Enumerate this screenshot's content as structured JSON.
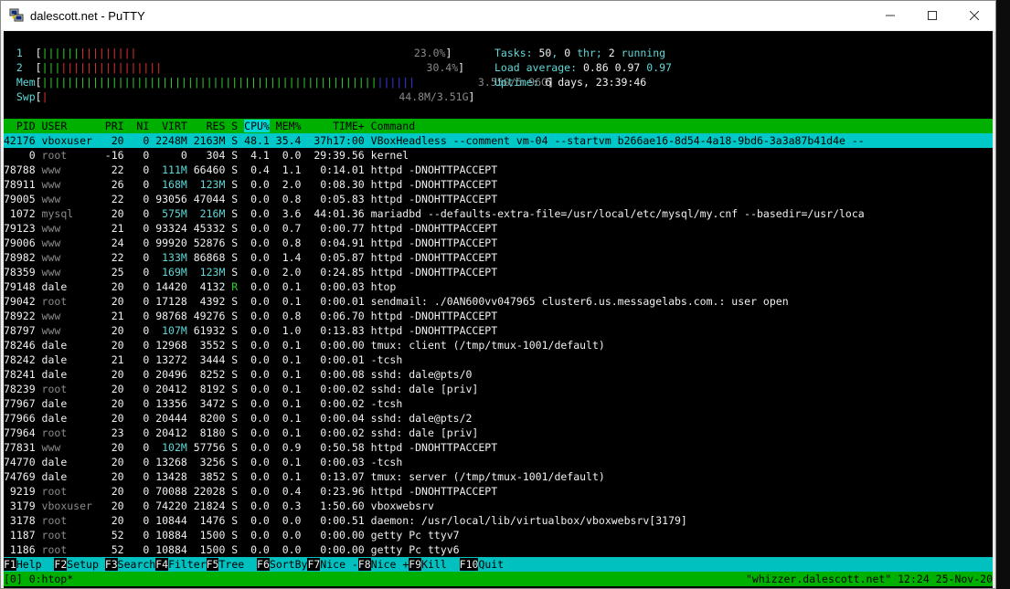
{
  "window": {
    "title": "dalescott.net - PuTTY",
    "icon": "putty-icon"
  },
  "meters": {
    "cpu1": {
      "label": "1",
      "bars_green": "||||||",
      "bars_red": "|||||||||",
      "value": "23.0%"
    },
    "cpu2": {
      "label": "2",
      "bars_green": "|||",
      "bars_red": "||||||||||||||||",
      "value": "30.4%"
    },
    "mem": {
      "label": "Mem",
      "bars_green": "|||||||||||||||||||||||||||||||||||||||||||||||||||||",
      "bars_blue": "||||||",
      "value": "3.55G/5.96G"
    },
    "swp": {
      "label": "Swp",
      "bars_red": "|",
      "value": "44.8M/3.51G"
    }
  },
  "summary": {
    "tasks_label": "Tasks:",
    "tasks_value": "50",
    "threads_value": "0",
    "thr_label": "thr;",
    "running_value": "2",
    "running_label": "running",
    "load_label": "Load average:",
    "load1": "0.86",
    "load5": "0.97",
    "load15": "0.97",
    "uptime_label": "Uptime:",
    "uptime_value": "6 days, 23:39:46"
  },
  "header": {
    "pid": "  PID",
    "user": "USER",
    "pri": "PRI",
    "ni": "NI",
    "virt": "VIRT",
    "res": "RES",
    "s": "S",
    "cpu": "CPU%",
    "mem": "MEM%",
    "time": "TIME+",
    "command": "Command"
  },
  "processes": [
    {
      "pid": "42176",
      "user": "vboxuser",
      "pri": "20",
      "ni": "0",
      "virt": "2248M",
      "res": "2163M",
      "s": "S",
      "cpu": "48.1",
      "mem": "35.4",
      "time": "37h17:00",
      "cmd": "VBoxHeadless --comment vm-04 --startvm b266ae16-8d54-4a18-9bd6-3a3a87b41d4e --"
    },
    {
      "pid": "0",
      "user": "root",
      "pri": "-16",
      "ni": "0",
      "virt": "0",
      "res": "304",
      "s": "S",
      "cpu": "4.1",
      "mem": "0.0",
      "time": "29:39.56",
      "cmd": "kernel"
    },
    {
      "pid": "78788",
      "user": "www",
      "pri": "22",
      "ni": "0",
      "virt": "111M",
      "res": "66460",
      "s": "S",
      "cpu": "0.4",
      "mem": "1.1",
      "time": "0:14.01",
      "cmd": "httpd -DNOHTTPACCEPT"
    },
    {
      "pid": "78911",
      "user": "www",
      "pri": "26",
      "ni": "0",
      "virt": "168M",
      "res": "123M",
      "s": "S",
      "cpu": "0.0",
      "mem": "2.0",
      "time": "0:08.30",
      "cmd": "httpd -DNOHTTPACCEPT"
    },
    {
      "pid": "79005",
      "user": "www",
      "pri": "22",
      "ni": "0",
      "virt": "93056",
      "res": "47044",
      "s": "S",
      "cpu": "0.0",
      "mem": "0.8",
      "time": "0:05.83",
      "cmd": "httpd -DNOHTTPACCEPT"
    },
    {
      "pid": "1072",
      "user": "mysql",
      "pri": "20",
      "ni": "0",
      "virt": "575M",
      "res": "216M",
      "s": "S",
      "cpu": "0.0",
      "mem": "3.6",
      "time": "44:01.36",
      "cmd": "mariadbd --defaults-extra-file=/usr/local/etc/mysql/my.cnf --basedir=/usr/loca"
    },
    {
      "pid": "79123",
      "user": "www",
      "pri": "21",
      "ni": "0",
      "virt": "93324",
      "res": "45332",
      "s": "S",
      "cpu": "0.0",
      "mem": "0.7",
      "time": "0:00.77",
      "cmd": "httpd -DNOHTTPACCEPT"
    },
    {
      "pid": "79006",
      "user": "www",
      "pri": "24",
      "ni": "0",
      "virt": "99920",
      "res": "52876",
      "s": "S",
      "cpu": "0.0",
      "mem": "0.8",
      "time": "0:04.91",
      "cmd": "httpd -DNOHTTPACCEPT"
    },
    {
      "pid": "78982",
      "user": "www",
      "pri": "22",
      "ni": "0",
      "virt": "133M",
      "res": "86868",
      "s": "S",
      "cpu": "0.0",
      "mem": "1.4",
      "time": "0:05.87",
      "cmd": "httpd -DNOHTTPACCEPT"
    },
    {
      "pid": "78359",
      "user": "www",
      "pri": "25",
      "ni": "0",
      "virt": "169M",
      "res": "123M",
      "s": "S",
      "cpu": "0.0",
      "mem": "2.0",
      "time": "0:24.85",
      "cmd": "httpd -DNOHTTPACCEPT"
    },
    {
      "pid": "79148",
      "user": "dale",
      "pri": "20",
      "ni": "0",
      "virt": "14420",
      "res": "4132",
      "s": "R",
      "cpu": "0.0",
      "mem": "0.1",
      "time": "0:00.03",
      "cmd": "htop"
    },
    {
      "pid": "79042",
      "user": "root",
      "pri": "20",
      "ni": "0",
      "virt": "17128",
      "res": "4392",
      "s": "S",
      "cpu": "0.0",
      "mem": "0.1",
      "time": "0:00.01",
      "cmd": "sendmail: ./0AN600vv047965 cluster6.us.messagelabs.com.: user open"
    },
    {
      "pid": "78922",
      "user": "www",
      "pri": "21",
      "ni": "0",
      "virt": "98768",
      "res": "49276",
      "s": "S",
      "cpu": "0.0",
      "mem": "0.8",
      "time": "0:06.70",
      "cmd": "httpd -DNOHTTPACCEPT"
    },
    {
      "pid": "78797",
      "user": "www",
      "pri": "20",
      "ni": "0",
      "virt": "107M",
      "res": "61932",
      "s": "S",
      "cpu": "0.0",
      "mem": "1.0",
      "time": "0:13.83",
      "cmd": "httpd -DNOHTTPACCEPT"
    },
    {
      "pid": "78246",
      "user": "dale",
      "pri": "20",
      "ni": "0",
      "virt": "12968",
      "res": "3552",
      "s": "S",
      "cpu": "0.0",
      "mem": "0.1",
      "time": "0:00.00",
      "cmd": "tmux: client (/tmp/tmux-1001/default)"
    },
    {
      "pid": "78242",
      "user": "dale",
      "pri": "21",
      "ni": "0",
      "virt": "13272",
      "res": "3444",
      "s": "S",
      "cpu": "0.0",
      "mem": "0.1",
      "time": "0:00.01",
      "cmd": "-tcsh"
    },
    {
      "pid": "78241",
      "user": "dale",
      "pri": "20",
      "ni": "0",
      "virt": "20496",
      "res": "8252",
      "s": "S",
      "cpu": "0.0",
      "mem": "0.1",
      "time": "0:00.08",
      "cmd": "sshd: dale@pts/0"
    },
    {
      "pid": "78239",
      "user": "root",
      "pri": "20",
      "ni": "0",
      "virt": "20412",
      "res": "8192",
      "s": "S",
      "cpu": "0.0",
      "mem": "0.1",
      "time": "0:00.02",
      "cmd": "sshd: dale [priv]"
    },
    {
      "pid": "77967",
      "user": "dale",
      "pri": "20",
      "ni": "0",
      "virt": "13356",
      "res": "3472",
      "s": "S",
      "cpu": "0.0",
      "mem": "0.1",
      "time": "0:00.02",
      "cmd": "-tcsh"
    },
    {
      "pid": "77966",
      "user": "dale",
      "pri": "20",
      "ni": "0",
      "virt": "20444",
      "res": "8200",
      "s": "S",
      "cpu": "0.0",
      "mem": "0.1",
      "time": "0:00.04",
      "cmd": "sshd: dale@pts/2"
    },
    {
      "pid": "77964",
      "user": "root",
      "pri": "23",
      "ni": "0",
      "virt": "20412",
      "res": "8180",
      "s": "S",
      "cpu": "0.0",
      "mem": "0.1",
      "time": "0:00.02",
      "cmd": "sshd: dale [priv]"
    },
    {
      "pid": "77831",
      "user": "www",
      "pri": "20",
      "ni": "0",
      "virt": "102M",
      "res": "57756",
      "s": "S",
      "cpu": "0.0",
      "mem": "0.9",
      "time": "0:50.58",
      "cmd": "httpd -DNOHTTPACCEPT"
    },
    {
      "pid": "74770",
      "user": "dale",
      "pri": "20",
      "ni": "0",
      "virt": "13268",
      "res": "3256",
      "s": "S",
      "cpu": "0.0",
      "mem": "0.1",
      "time": "0:00.03",
      "cmd": "-tcsh"
    },
    {
      "pid": "74769",
      "user": "dale",
      "pri": "20",
      "ni": "0",
      "virt": "13428",
      "res": "3852",
      "s": "S",
      "cpu": "0.0",
      "mem": "0.1",
      "time": "0:13.07",
      "cmd": "tmux: server (/tmp/tmux-1001/default)"
    },
    {
      "pid": "9219",
      "user": "root",
      "pri": "20",
      "ni": "0",
      "virt": "70088",
      "res": "22028",
      "s": "S",
      "cpu": "0.0",
      "mem": "0.4",
      "time": "0:23.96",
      "cmd": "httpd -DNOHTTPACCEPT"
    },
    {
      "pid": "3179",
      "user": "vboxuser",
      "pri": "20",
      "ni": "0",
      "virt": "74220",
      "res": "21824",
      "s": "S",
      "cpu": "0.0",
      "mem": "0.3",
      "time": "1:50.60",
      "cmd": "vboxwebsrv"
    },
    {
      "pid": "3178",
      "user": "root",
      "pri": "20",
      "ni": "0",
      "virt": "10844",
      "res": "1476",
      "s": "S",
      "cpu": "0.0",
      "mem": "0.0",
      "time": "0:00.51",
      "cmd": "daemon: /usr/local/lib/virtualbox/vboxwebsrv[3179]"
    },
    {
      "pid": "1187",
      "user": "root",
      "pri": "52",
      "ni": "0",
      "virt": "10884",
      "res": "1500",
      "s": "S",
      "cpu": "0.0",
      "mem": "0.0",
      "time": "0:00.00",
      "cmd": "getty Pc ttyv7"
    },
    {
      "pid": "1186",
      "user": "root",
      "pri": "52",
      "ni": "0",
      "virt": "10884",
      "res": "1500",
      "s": "S",
      "cpu": "0.0",
      "mem": "0.0",
      "time": "0:00.00",
      "cmd": "getty Pc ttyv6"
    }
  ],
  "fkeys": [
    {
      "key": "F1",
      "label": "Help  "
    },
    {
      "key": "F2",
      "label": "Setup "
    },
    {
      "key": "F3",
      "label": "Search"
    },
    {
      "key": "F4",
      "label": "Filter"
    },
    {
      "key": "F5",
      "label": "Tree  "
    },
    {
      "key": "F6",
      "label": "SortBy"
    },
    {
      "key": "F7",
      "label": "Nice -"
    },
    {
      "key": "F8",
      "label": "Nice +"
    },
    {
      "key": "F9",
      "label": "Kill  "
    },
    {
      "key": "F10",
      "label": "Quit"
    }
  ],
  "tmux": {
    "left": "[0] 0:htop*",
    "right": "\"whizzer.dalescott.net\" 12:24 25-Nov-20"
  }
}
